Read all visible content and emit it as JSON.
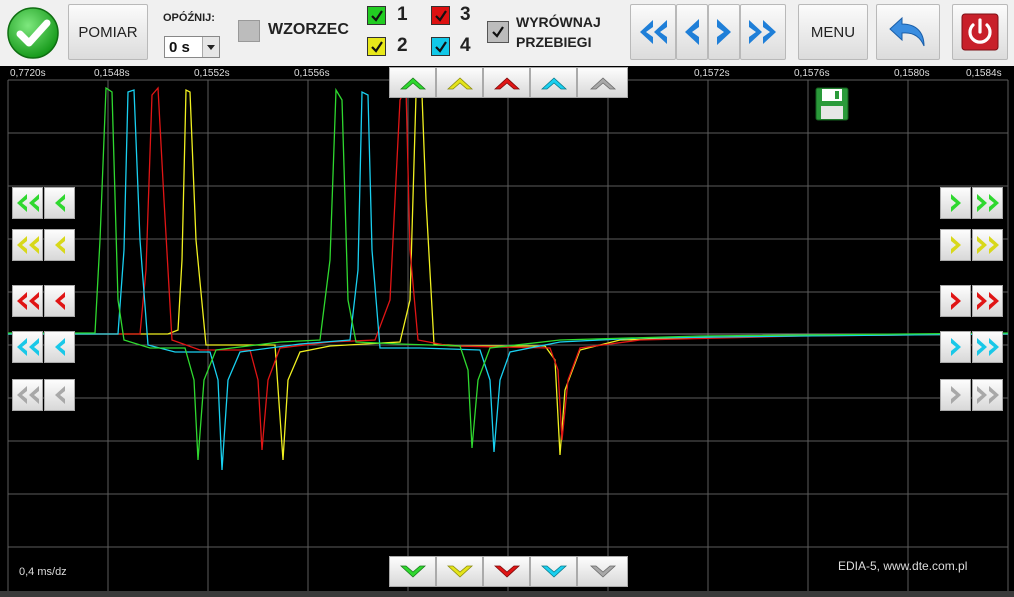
{
  "toolbar": {
    "pomiar_label": "POMIAR",
    "delay_label": "OPÓŹNIJ:",
    "delay_value": "0 s",
    "pattern_label": "WZORZEC",
    "channels": [
      {
        "num": "1",
        "color": "#22cc22",
        "checked": true
      },
      {
        "num": "2",
        "color": "#e8e81a",
        "checked": true
      },
      {
        "num": "3",
        "color": "#dd1111",
        "checked": true
      },
      {
        "num": "4",
        "color": "#11c8e8",
        "checked": true
      }
    ],
    "align_label_1": "WYRÓWNAJ",
    "align_label_2": "PRZEBIEGI",
    "menu_label": "MENU"
  },
  "scope": {
    "time_ticks": [
      "0,7720s",
      "0,1548s",
      "0,1552s",
      "0,1556s",
      "0,1572s",
      "0,1576s",
      "0,1580s",
      "0,1584s"
    ],
    "timebase": "0,4 ms/dz",
    "footer": "EDIA-5, www.dte.com.pl"
  },
  "colors": {
    "ch1": "#2fd82f",
    "ch2": "#f0f020",
    "ch3": "#e01515",
    "ch4": "#19d0f0",
    "ch5": "#a8a8a8",
    "accent_blue": "#1f7fd8",
    "power_red": "#c8202a"
  },
  "icons": {
    "ok": "check-circle-icon",
    "save": "floppy-disk-icon",
    "back": "back-arrow-icon",
    "power": "power-icon"
  }
}
